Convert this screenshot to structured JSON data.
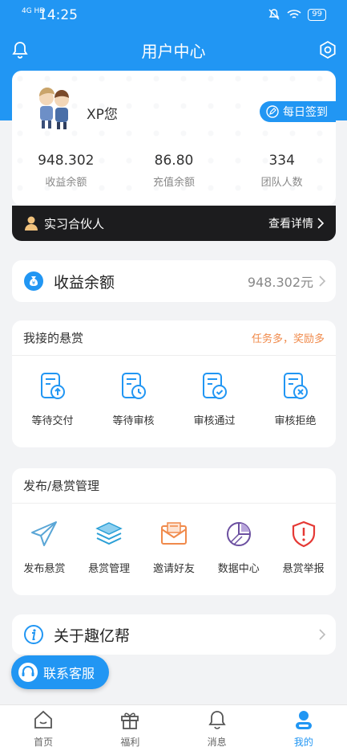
{
  "status": {
    "time": "14:25",
    "signal": "4G HD",
    "battery": "99"
  },
  "header": {
    "title": "用户中心"
  },
  "profile": {
    "username": "XP您",
    "checkin_label": "每日签到",
    "stats": [
      {
        "value": "948.302",
        "label": "收益余额"
      },
      {
        "value": "86.80",
        "label": "充值余额"
      },
      {
        "value": "334",
        "label": "团队人数"
      }
    ],
    "partner_label": "实习合伙人",
    "partner_detail": "查看详情"
  },
  "balance": {
    "label": "收益余额",
    "amount": "948.302元"
  },
  "reward_section": {
    "title": "我接的悬赏",
    "hint": "任务多，奖励多",
    "items": [
      {
        "label": "等待交付",
        "icon": "doc-upload-icon"
      },
      {
        "label": "等待审核",
        "icon": "doc-clock-icon"
      },
      {
        "label": "审核通过",
        "icon": "doc-check-icon"
      },
      {
        "label": "审核拒绝",
        "icon": "doc-reject-icon"
      }
    ]
  },
  "publish_section": {
    "title": "发布/悬赏管理",
    "items": [
      {
        "label": "发布悬赏",
        "icon": "paper-plane-icon"
      },
      {
        "label": "悬赏管理",
        "icon": "layers-icon"
      },
      {
        "label": "邀请好友",
        "icon": "mail-invite-icon"
      },
      {
        "label": "数据中心",
        "icon": "pie-chart-icon"
      },
      {
        "label": "悬赏举报",
        "icon": "shield-alert-icon"
      }
    ]
  },
  "about": {
    "label": "关于趣亿帮"
  },
  "service": {
    "label": "联系客服"
  },
  "tabs": [
    {
      "label": "首页",
      "icon": "home-icon"
    },
    {
      "label": "福利",
      "icon": "gift-icon"
    },
    {
      "label": "消息",
      "icon": "bell-icon"
    },
    {
      "label": "我的",
      "icon": "user-icon"
    }
  ],
  "colors": {
    "primary": "#2196f3",
    "accent": "#f08a4b",
    "danger": "#e53935"
  }
}
